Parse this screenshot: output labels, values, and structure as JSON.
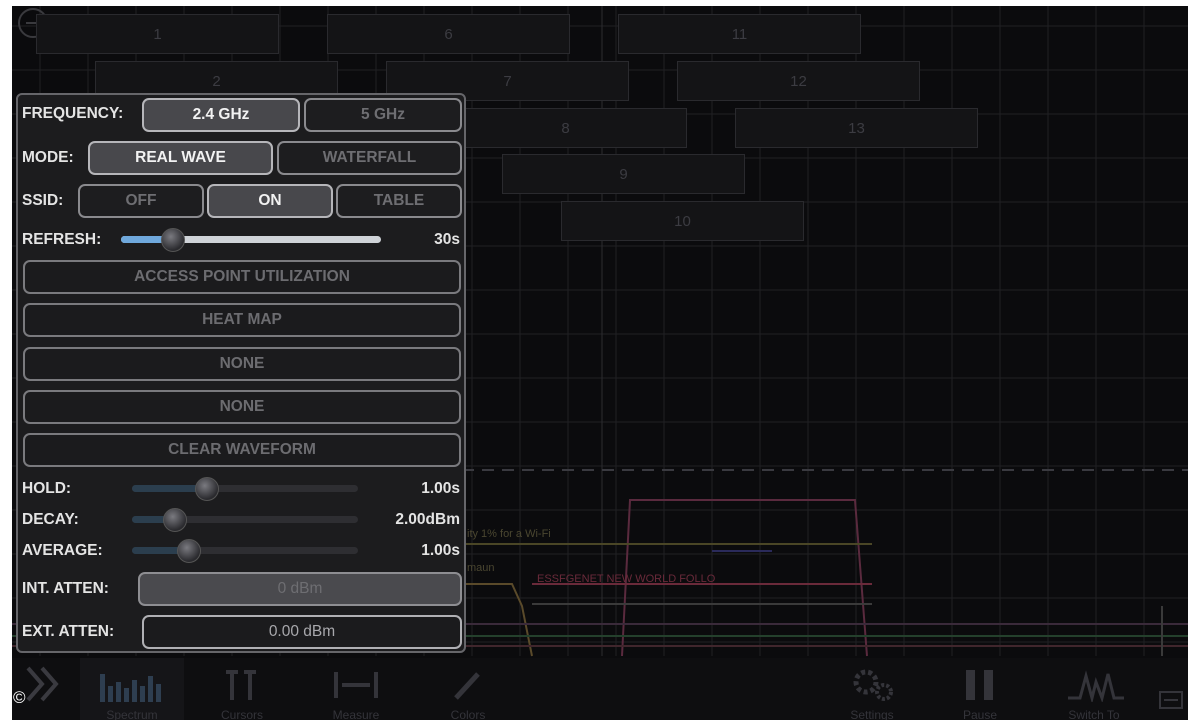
{
  "channels": [
    {
      "label": "1"
    },
    {
      "label": "6"
    },
    {
      "label": "11"
    },
    {
      "label": "2"
    },
    {
      "label": "7"
    },
    {
      "label": "12"
    },
    {
      "label": "8"
    },
    {
      "label": "13"
    },
    {
      "label": "9"
    },
    {
      "label": "10"
    }
  ],
  "spectrum_labels": {
    "label_a": "ity 1% for a Wi-Fi",
    "label_b": "maun",
    "label_c": "ESSFGENET NEW WORLD FOLLO"
  },
  "panel": {
    "frequency": {
      "label": "FREQUENCY:",
      "options": [
        "2.4 GHz",
        "5 GHz"
      ],
      "selected": "2.4 GHz"
    },
    "mode": {
      "label": "MODE:",
      "options": [
        "REAL WAVE",
        "WATERFALL"
      ],
      "selected": "REAL WAVE"
    },
    "ssid": {
      "label": "SSID:",
      "options": [
        "OFF",
        "ON",
        "TABLE"
      ],
      "selected": "ON"
    },
    "refresh": {
      "label": "REFRESH:",
      "value": "30s",
      "position": 0.2
    },
    "buttons": [
      "ACCESS POINT UTILIZATION",
      "HEAT MAP",
      "NONE",
      "NONE",
      "CLEAR WAVEFORM"
    ],
    "hold": {
      "label": "HOLD:",
      "value": "1.00s",
      "position": 0.33
    },
    "decay": {
      "label": "DECAY:",
      "value": "2.00dBm",
      "position": 0.19
    },
    "average": {
      "label": "AVERAGE:",
      "value": "1.00s",
      "position": 0.25
    },
    "int_atten": {
      "label": "INT. ATTEN:",
      "value": "0 dBm"
    },
    "ext_atten": {
      "label": "EXT. ATTEN:",
      "value": "0.00 dBm"
    }
  },
  "toolbar": {
    "items": [
      {
        "label": "Spectrum",
        "icon": "spectrum-bars-icon"
      },
      {
        "label": "Cursors",
        "icon": "cursors-icon"
      },
      {
        "label": "Measure",
        "icon": "measure-icon"
      },
      {
        "label": "Colors",
        "icon": "eyedropper-icon"
      },
      {
        "label": "Settings",
        "icon": "gears-icon"
      },
      {
        "label": "Pause",
        "icon": "pause-icon"
      },
      {
        "label": "Switch To",
        "icon": "waveform-icon"
      }
    ]
  },
  "copyright": "©",
  "colors": {
    "background": "#0b0b0d",
    "panel": "#1c1c1e",
    "active_segment": "#48484c",
    "slider_blue": "#6fa8dc"
  }
}
